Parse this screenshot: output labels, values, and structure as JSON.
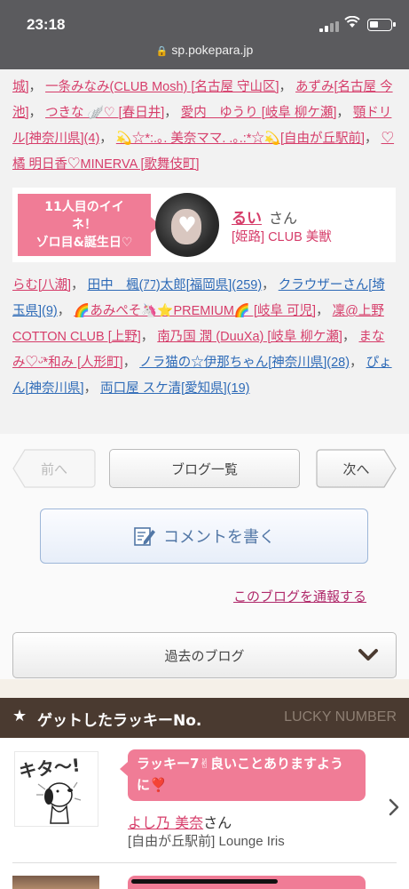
{
  "status": {
    "time": "23:18",
    "url": "sp.pokepara.jp"
  },
  "block1": {
    "links": [
      {
        "text": "城]"
      },
      {
        "text": "一条みなみ(CLUB Mosh) [名古屋 守山区]"
      },
      {
        "text": "あずみ[名古屋 今池]"
      },
      {
        "text": "つきな 🪽♡ [春日井]"
      },
      {
        "text": "愛内　ゆうり [岐阜 柳ケ瀬]"
      },
      {
        "text": "顎ドリル[神奈川県](4)"
      },
      {
        "text": "💫☆*:.｡. 美奈ママ. .｡.:*☆💫[自由が丘駅前]"
      },
      {
        "text": "♡橘 明日香♡MINERVA [歌舞伎町]"
      }
    ]
  },
  "featured": {
    "badge": "11人目のイイネ！\nゾロ目&誕生日♡",
    "badge_line1": "11人目のイイ",
    "badge_line2": "ネ！",
    "badge_line3": "ゾロ目&誕生日♡",
    "name": "るい",
    "suffix": "さん",
    "shop": "[姫路] CLUB 美獣"
  },
  "block2": {
    "links": [
      {
        "text": "らむ[八潮]",
        "color": "pink"
      },
      {
        "text": "田中　楓(ｱﾌ)太郎[福岡県](259)",
        "color": "blue"
      },
      {
        "text": "クラウザーさん[埼玉県](9)",
        "color": "blue"
      },
      {
        "text": "🌈あみぺそ🦄⭐PREMIUM🌈 [岐阜 可児]",
        "color": "pink"
      },
      {
        "text": "凜@上野COTTON CLUB [上野]",
        "color": "pink"
      },
      {
        "text": "南乃国 潤 (DuuXa) [岐阜 柳ケ瀬]",
        "color": "pink"
      },
      {
        "text": "まなみ♡ᵕ̈*和み [人形町]",
        "color": "pink"
      },
      {
        "text": "ノラ猫の☆伊那ちゃん[神奈川県](28)",
        "color": "blue"
      },
      {
        "text": "ぴょん[神奈川県]",
        "color": "blue"
      },
      {
        "text": "両口屋 スケ清[愛知県](19)",
        "color": "blue"
      }
    ]
  },
  "nav": {
    "prev": "前へ",
    "list": "ブログ一覧",
    "next": "次へ",
    "comment": "コメントを書く",
    "report": "このブログを通報する",
    "past": "過去のブログ"
  },
  "lucky": {
    "title": "ゲットしたラッキーNo.",
    "title_en": "LUCKY NUMBER",
    "stamp_text": "キタ〜!",
    "message": "ラッキー7✌良いことありますように❣️",
    "name": "よし乃 美奈",
    "suffix": "さん",
    "shop": "[自由が丘駅前] Lounge Iris"
  },
  "colors": {
    "accent": "#f07c96",
    "link_pink": "#d63d6a",
    "link_blue": "#2d6ab7",
    "bar": "#4a3a30"
  }
}
